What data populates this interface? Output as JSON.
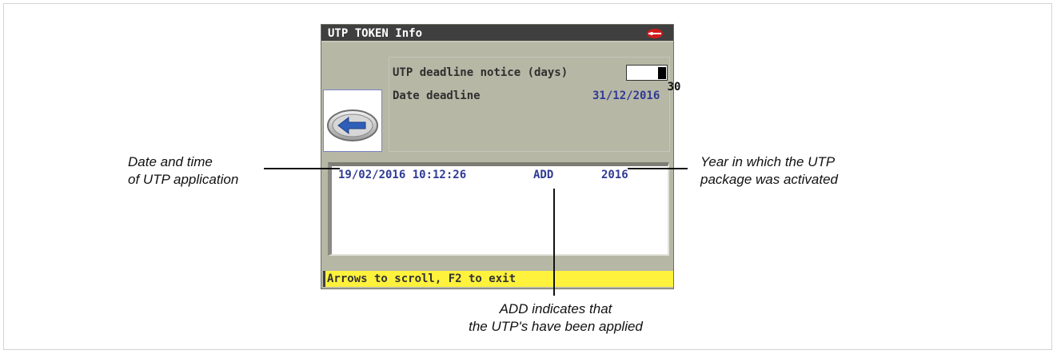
{
  "window": {
    "title": "UTP TOKEN Info",
    "brand_icon": "silca-logo-icon"
  },
  "info": {
    "deadline_notice_label": "UTP deadline notice (days)",
    "deadline_notice_value": "30",
    "date_deadline_label": "Date deadline",
    "date_deadline_value": "31/12/2016"
  },
  "back_button": {
    "icon": "left-arrow-icon"
  },
  "log": {
    "rows": [
      {
        "datetime": "19/02/2016 10:12:26",
        "action": "ADD",
        "year": "2016"
      }
    ]
  },
  "statusbar": {
    "text": "Arrows to scroll, F2 to exit"
  },
  "callouts": {
    "left_line1": "Date and time",
    "left_line2": "of UTP application",
    "right_line1": "Year in which the UTP",
    "right_line2": "package was activated",
    "bottom_line1": "ADD indicates that",
    "bottom_line2": "the UTP's have been applied"
  },
  "colors": {
    "screen_bg": "#b7b7a6",
    "titlebar_bg": "#3f3f3f",
    "value_text": "#2f3a94",
    "statusbar_bg": "#fff23d"
  }
}
